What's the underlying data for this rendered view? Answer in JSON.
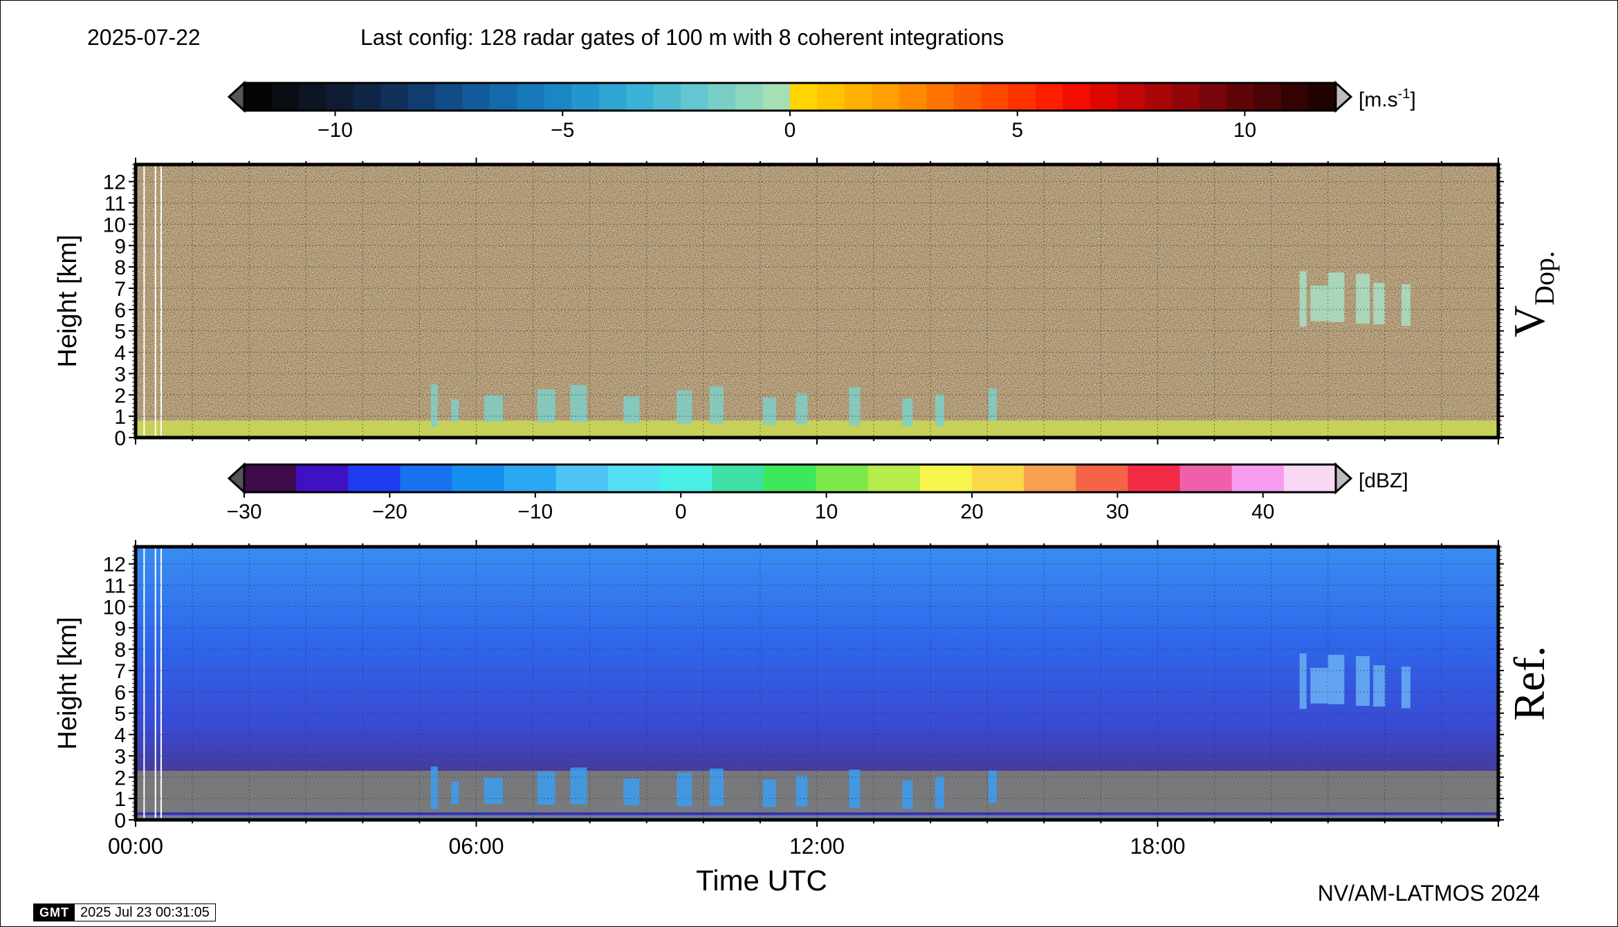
{
  "header": {
    "date": "2025-07-22",
    "config": "Last config: 128 radar gates of 100 m with 8 coherent integrations"
  },
  "footer": {
    "credit": "NV/AM-LATMOS 2024",
    "gmt_logo": "GMT",
    "timestamp": "2025 Jul 23 00:31:05"
  },
  "chart_data": [
    {
      "type": "heatmap",
      "quantity_label": "V",
      "quantity_subscript": "Dop.",
      "xlabel": "",
      "ylabel": "Height [km]",
      "x_range_hours": [
        0,
        24
      ],
      "ylim": [
        0,
        12.8
      ],
      "y_ticks": [
        0,
        1,
        2,
        3,
        4,
        5,
        6,
        7,
        8,
        9,
        10,
        11,
        12
      ],
      "colorbar": {
        "unit": "[m.s",
        "unit_superscript": "-1",
        "unit_close": "]",
        "range": [
          -12,
          12
        ],
        "tick_labels": [
          "−10",
          "−5",
          "0",
          "5",
          "10"
        ],
        "tick_values": [
          -10,
          -5,
          0,
          5,
          10
        ],
        "colors_negative": [
          "#050507",
          "#0a0d14",
          "#0d1422",
          "#0f1b33",
          "#102545",
          "#10305a",
          "#103d70",
          "#124c86",
          "#135b9b",
          "#1469ab",
          "#1678b9",
          "#1a87c4",
          "#2396cd",
          "#2ea5d3",
          "#3ab2d6",
          "#4ebcd3",
          "#64c6ce",
          "#78cfc5",
          "#8ed8bd",
          "#a4e0b4"
        ],
        "colors_positive": [
          "#ffd400",
          "#ffc300",
          "#ffb100",
          "#ff9f00",
          "#ff8a00",
          "#ff7400",
          "#ff5e00",
          "#ff4800",
          "#ff3300",
          "#ff1e00",
          "#f20d00",
          "#dc0800",
          "#c40606",
          "#aa0608",
          "#900609",
          "#770509",
          "#5f0508",
          "#480406",
          "#330304",
          "#200203"
        ],
        "left_arrow_color": "#555555",
        "right_arrow_color": "#bdbdbd"
      },
      "features": [
        {
          "name": "near-surface layer",
          "height_km": [
            0,
            0.8
          ],
          "color": "#c8d458"
        },
        {
          "name": "low cloud echoes",
          "hours": [
            5.2,
            15.6
          ],
          "height_km": [
            0.5,
            2.5
          ],
          "color": "#7fcfc8"
        },
        {
          "name": "mid-level echoes",
          "hours": [
            20.5,
            22.6
          ],
          "height_km": [
            5.2,
            7.8
          ],
          "color": "#a9dfc6"
        }
      ]
    },
    {
      "type": "heatmap",
      "quantity_label": "Ref.",
      "xlabel": "Time UTC",
      "ylabel": "Height [km]",
      "x_range_hours": [
        0,
        24
      ],
      "x_tick_labels": [
        "00:00",
        "06:00",
        "12:00",
        "18:00"
      ],
      "x_tick_hours": [
        0,
        6,
        12,
        18
      ],
      "ylim": [
        0,
        12.8
      ],
      "y_ticks": [
        0,
        1,
        2,
        3,
        4,
        5,
        6,
        7,
        8,
        9,
        10,
        11,
        12
      ],
      "colorbar": {
        "unit": "[dBZ]",
        "range": [
          -30,
          45
        ],
        "tick_labels": [
          "−30",
          "−20",
          "−10",
          "0",
          "10",
          "20",
          "30",
          "40"
        ],
        "tick_values": [
          -30,
          -20,
          -10,
          0,
          10,
          20,
          30,
          40
        ],
        "colors": [
          "#3e0b4a",
          "#3f10c4",
          "#1f3cf0",
          "#1672ef",
          "#168ef0",
          "#2aa8f3",
          "#4dc5f6",
          "#54e0f5",
          "#48f0e8",
          "#3ee0a6",
          "#3ee85a",
          "#7ce84a",
          "#b6ec4c",
          "#f6f64c",
          "#fad84a",
          "#f8a050",
          "#f56446",
          "#f22a46",
          "#f060a8",
          "#f79cf0",
          "#f8d8f4"
        ],
        "left_arrow_color": "#555555",
        "right_arrow_color": "#bdbdbd"
      },
      "features": [
        {
          "name": "clear-air noise",
          "height_km": [
            2.5,
            12.8
          ],
          "color": "#1b56e6"
        },
        {
          "name": "no-data band",
          "height_km": [
            0.4,
            2.3
          ],
          "color": "#7a7a7a"
        },
        {
          "name": "low cloud echoes",
          "hours": [
            5.2,
            15.6
          ],
          "height_km": [
            0.5,
            2.5
          ],
          "color": "#3b9ef2"
        },
        {
          "name": "mid-level echoes",
          "hours": [
            20.5,
            22.6
          ],
          "height_km": [
            5.2,
            7.8
          ],
          "color": "#6ab0f5"
        }
      ]
    }
  ]
}
